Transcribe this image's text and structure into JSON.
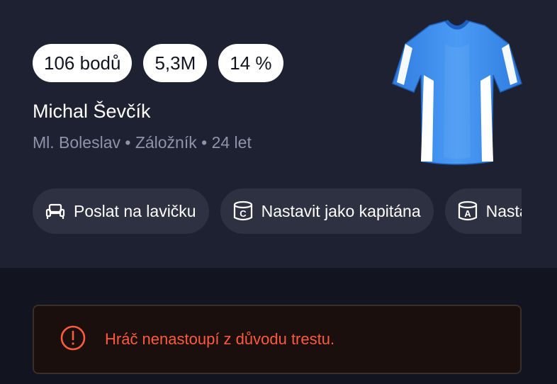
{
  "player": {
    "stats": {
      "points": "106 bodů",
      "price": "5,3M",
      "ownership": "14 %"
    },
    "name": "Michal Ševčík",
    "meta": "Ml. Boleslav • Záložník • 24 let",
    "jersey": {
      "primary_color": "#3a8ff2",
      "trim_color": "#ffffff",
      "icon": "jersey-icon"
    }
  },
  "actions": [
    {
      "label": "Poslat na lavičku",
      "icon": "bench-icon"
    },
    {
      "label": "Nastavit jako kapitána",
      "icon": "captain-armband-icon",
      "icon_letter": "C"
    },
    {
      "label": "Nastavit jako asistenta",
      "icon": "assistant-armband-icon",
      "icon_letter": "A"
    }
  ],
  "alert": {
    "message": "Hráč nenastoupí z důvodu trestu.",
    "icon": "alert-circle-icon",
    "color": "#ff5a3c"
  }
}
